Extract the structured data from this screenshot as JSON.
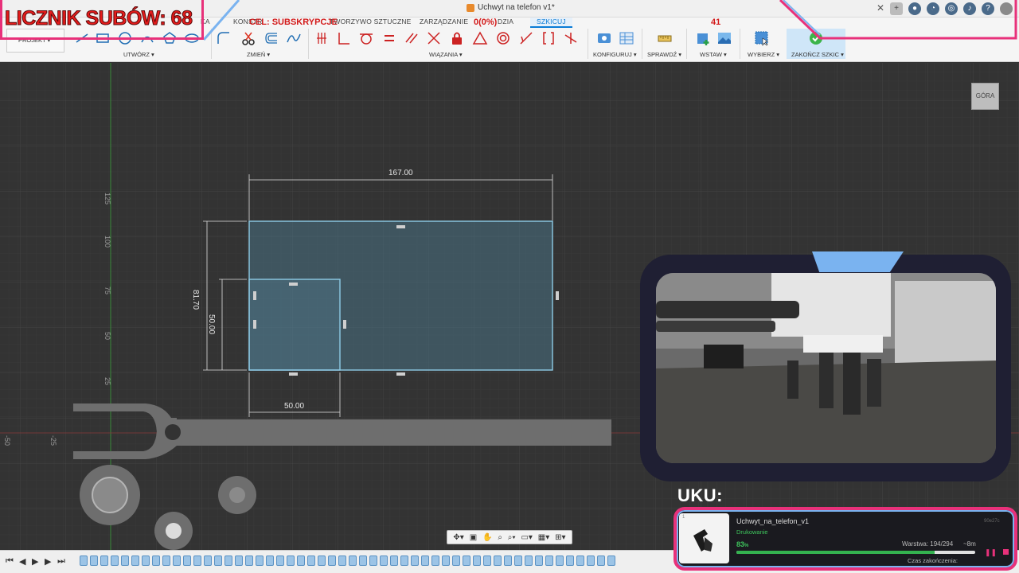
{
  "window": {
    "doc_title": "Uchwyt na telefon v1*",
    "close_symbol": "✕"
  },
  "ribbon": {
    "projekt_label": "PROJEKT ▾",
    "tabs": [
      {
        "label": "KA",
        "active": false
      },
      {
        "label": "KONSTR",
        "active": false
      },
      {
        "label": "TWORZYWO SZTUCZNE",
        "active": false
      },
      {
        "label": "ZARZĄDZANIE",
        "active": false
      },
      {
        "label": "DZIA",
        "active": false
      },
      {
        "label": "SZKICUJ",
        "active": true
      }
    ],
    "groups": {
      "create": "UTWÓRZ ▾",
      "modify": "ZMIEŃ ▾",
      "constraints": "WIĄZANIA ▾",
      "configure": "KONFIGURUJ ▾",
      "inspect": "SPRAWDŹ ▾",
      "insert": "WSTAW ▾",
      "select": "WYBIERZ ▾",
      "finish": "ZAKOŃCZ SZKIC ▾"
    }
  },
  "viewcube": {
    "label": "GÓRA"
  },
  "sketch": {
    "dims": {
      "width_total": "167.00",
      "height_total": "81.70",
      "inner_height": "50.00",
      "inner_width": "50.00"
    },
    "ruler_vertical": [
      "125",
      "100",
      "75",
      "50",
      "25"
    ],
    "ruler_horizontal": [
      "-50",
      "-25"
    ]
  },
  "overlay": {
    "sub_counter": "LICZNIK SUBÓW: 68",
    "goal_label": "CEL: SUBSKRYPCJE",
    "goal_progress": "0(0%)",
    "goal_target": "41",
    "druk_label": "UKU:",
    "accent_pink": "#e8317a",
    "accent_blue": "#7ab3f0"
  },
  "print": {
    "slot": "1",
    "name": "Uchwyt_na_telefon_v1",
    "status": "Drukowanie",
    "id": "90e27c",
    "percent": "83",
    "percent_unit": "%",
    "progress": 0.83,
    "layer": "Warstwa: 194/294",
    "eta": "~8m",
    "end_label": "Czas zakończenia:"
  }
}
